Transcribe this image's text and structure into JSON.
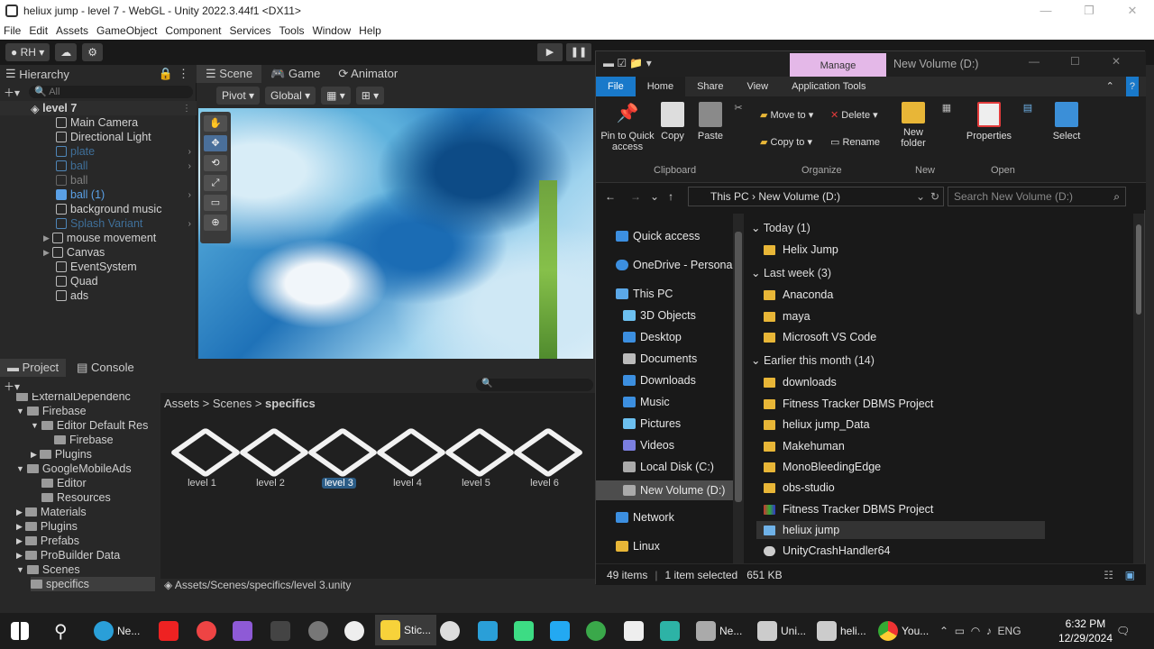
{
  "unity": {
    "title": "heliux jump - level 7 - WebGL - Unity 2022.3.44f1 <DX11>",
    "menu": [
      "File",
      "Edit",
      "Assets",
      "GameObject",
      "Component",
      "Services",
      "Tools",
      "Window",
      "Help"
    ],
    "account": "RH",
    "hierarchy": {
      "tab": "Hierarchy",
      "search_placeholder": "All",
      "scene": "level 7",
      "items": [
        "Main Camera",
        "Directional Light",
        "plate",
        "ball",
        "ball",
        "ball (1)",
        "background music",
        "Splash Variant",
        "mouse movement",
        "Canvas",
        "EventSystem",
        "Quad",
        "ads"
      ]
    },
    "scene_tabs": [
      "Scene",
      "Game",
      "Animator"
    ],
    "scene_toolbar": {
      "pivot": "Pivot",
      "global": "Global"
    },
    "project": {
      "tabs": [
        "Project",
        "Console"
      ],
      "tree": [
        "ExternalDependenc",
        "Firebase",
        "Editor Default Res",
        "Firebase",
        "Plugins",
        "GoogleMobileAds",
        "Editor",
        "Resources",
        "Materials",
        "Plugins",
        "Prefabs",
        "ProBuilder Data",
        "Scenes",
        "specifics"
      ],
      "breadcrumb": [
        "Assets",
        "Scenes",
        "specifics"
      ],
      "assets": [
        "level 1",
        "level 2",
        "level 3",
        "level 4",
        "level 5",
        "level 6"
      ],
      "path": "Assets/Scenes/specifics/level 3.unity"
    }
  },
  "explorer": {
    "manage": "Manage",
    "title": "New Volume (D:)",
    "tabs": [
      "File",
      "Home",
      "Share",
      "View",
      "Application Tools"
    ],
    "ribbon": {
      "pin": "Pin to Quick access",
      "copy": "Copy",
      "paste": "Paste",
      "move_to": "Move to",
      "copy_to": "Copy to",
      "delete": "Delete",
      "rename": "Rename",
      "new_folder": "New folder",
      "properties": "Properties",
      "select": "Select",
      "groups": [
        "Clipboard",
        "Organize",
        "New",
        "Open"
      ]
    },
    "address": [
      "This PC",
      "New Volume (D:)"
    ],
    "search_placeholder": "Search New Volume (D:)",
    "nav": [
      "Quick access",
      "OneDrive - Personal",
      "This PC",
      "3D Objects",
      "Desktop",
      "Documents",
      "Downloads",
      "Music",
      "Pictures",
      "Videos",
      "Local Disk (C:)",
      "New Volume (D:)",
      "Network",
      "Linux"
    ],
    "groups": [
      {
        "label": "Today (1)",
        "items": [
          "Helix Jump"
        ]
      },
      {
        "label": "Last week (3)",
        "items": [
          "Anaconda",
          "maya",
          "Microsoft VS Code"
        ]
      },
      {
        "label": "Earlier this month (14)",
        "items": [
          "downloads",
          "Fitness Tracker DBMS Project",
          "heliux jump_Data",
          "Makehuman",
          "MonoBleedingEdge",
          "obs-studio",
          "Fitness Tracker DBMS Project",
          "heliux jump",
          "UnityCrashHandler64"
        ]
      }
    ],
    "status": {
      "count": "49 items",
      "selected": "1 item selected",
      "size": "651 KB"
    }
  },
  "taskbar": {
    "items": [
      "Ne...",
      "Stic...",
      "Ne...",
      "Uni...",
      "heli...",
      "You..."
    ],
    "time": "6:32 PM",
    "date": "12/29/2024"
  },
  "colors": {
    "unity_bg": "#282828",
    "selection": "#2c5d87",
    "win_accent": "#1979ca",
    "folder": "#e8b637"
  }
}
